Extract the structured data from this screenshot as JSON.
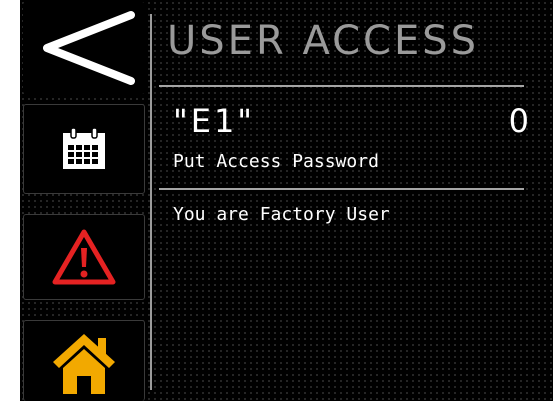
{
  "screen": {
    "title": "USER ACCESS"
  },
  "sidebar": {
    "items": [
      {
        "icon": "back-chevron-icon"
      },
      {
        "icon": "calendar-icon"
      },
      {
        "icon": "warning-icon"
      },
      {
        "icon": "home-icon"
      }
    ]
  },
  "access": {
    "code": "\"E1\"",
    "value": "0",
    "prompt": "Put Access Password",
    "status": "You are Factory User"
  },
  "colors": {
    "background": "#000000",
    "title": "#9a9a9a",
    "text": "#ffffff",
    "warning": "#e52222",
    "home": "#f2a900"
  }
}
